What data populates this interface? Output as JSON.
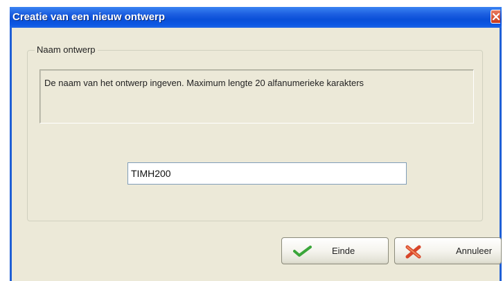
{
  "window": {
    "title": "Creatie van een nieuw ontwerp"
  },
  "group": {
    "legend": "Naam ontwerp",
    "description": "De naam van het ontwerp ingeven. Maximum lengte 20 alfanumerieke karakters"
  },
  "name_field": {
    "value": "TIMH200"
  },
  "buttons": {
    "ok_label": "Einde",
    "cancel_label": "Annuleer"
  },
  "icons": {
    "ok": "checkmark-icon",
    "cancel": "cross-icon",
    "close": "close-icon"
  },
  "colors": {
    "titlebar": "#0a4fd8",
    "dialog_background": "#ECE9D8",
    "check_green": "#3aa63a",
    "cross_red": "#d8462a"
  }
}
